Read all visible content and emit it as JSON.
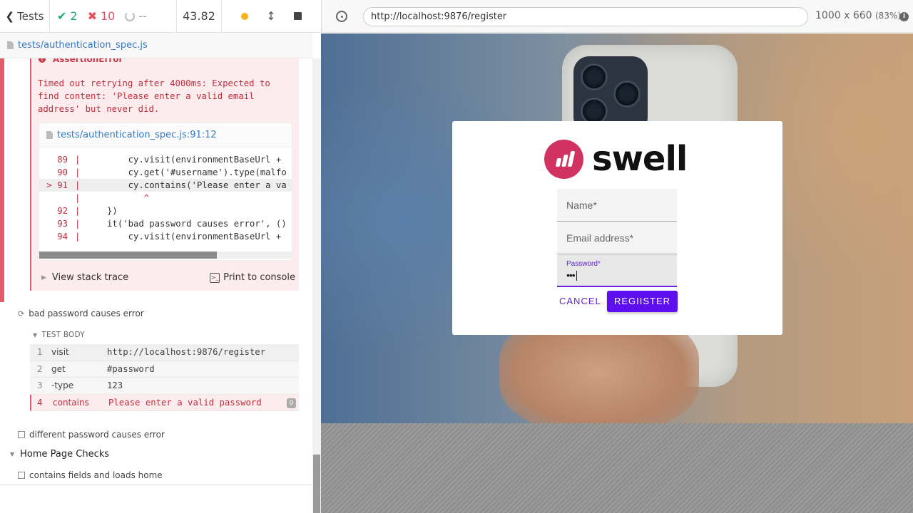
{
  "reporter": {
    "back_label": "Tests",
    "passed": "2",
    "failed": "10",
    "pending": "--",
    "duration": "43.82",
    "spec_path": "tests/authentication_spec.js"
  },
  "error": {
    "title": "AssertionError",
    "message": "Timed out retrying after 4000ms: Expected to find content: 'Please enter a valid email address' but never did.",
    "file_link": "tests/authentication_spec.js:91:12",
    "code_lines": [
      {
        "num": "89",
        "marker": "",
        "code": "        cy.visit(environmentBaseUrl + "
      },
      {
        "num": "90",
        "marker": "",
        "code": "        cy.get('#username').type(malfo"
      },
      {
        "num": "91",
        "marker": ">",
        "code": "        cy.contains('Please enter a va"
      },
      {
        "num": "",
        "marker": "",
        "code": "           ^"
      },
      {
        "num": "92",
        "marker": "",
        "code": "    })"
      },
      {
        "num": "93",
        "marker": "",
        "code": "    it('bad password causes error', ()"
      },
      {
        "num": "94",
        "marker": "",
        "code": "        cy.visit(environmentBaseUrl + "
      }
    ],
    "view_stack_trace": "View stack trace",
    "print_to_console": "Print to console"
  },
  "tests": {
    "current": "bad password causes error",
    "test_body_label": "TEST BODY",
    "commands": [
      {
        "num": "1",
        "name": "visit",
        "message": "http://localhost:9876/register"
      },
      {
        "num": "2",
        "name": "get",
        "message": "#password"
      },
      {
        "num": "3",
        "name": "-type",
        "message": "123"
      },
      {
        "num": "4",
        "name": "contains",
        "message": "Please enter a valid password",
        "badge": "0"
      }
    ],
    "next_test": "different password causes error",
    "suite": "Home Page Checks",
    "suite_test": "contains fields and loads home"
  },
  "aut": {
    "url": "http://localhost:9876/register",
    "viewport": "1000 x 660",
    "zoom": "(83%)"
  },
  "app": {
    "brand": "swell",
    "name_placeholder": "Name*",
    "email_placeholder": "Email address*",
    "password_label": "Password*",
    "password_value": "•••",
    "cancel_label": "CANCEL",
    "register_label": "REGIISTER",
    "colors": {
      "brand": "#d2325f",
      "primary": "#5d0ff0",
      "fail": "#e15b6b",
      "pass": "#1fa971"
    }
  }
}
